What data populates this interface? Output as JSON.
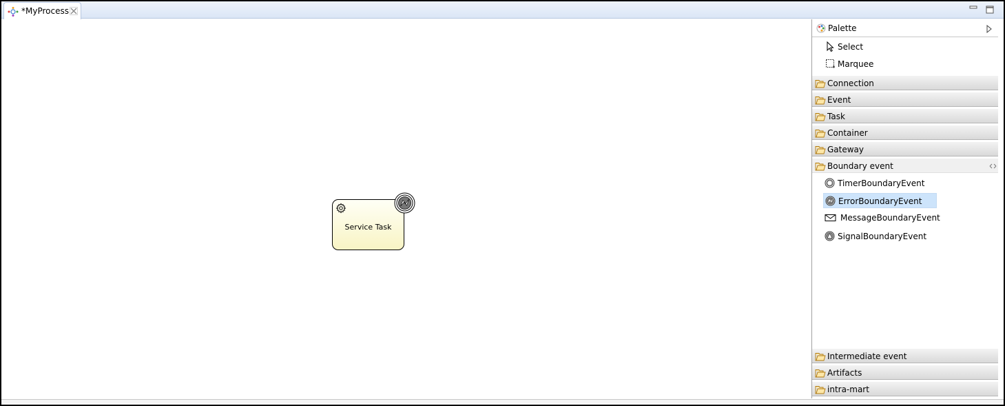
{
  "editor": {
    "tab_title": "*MyProcess"
  },
  "diagram": {
    "task_label": "Service Task"
  },
  "palette": {
    "title": "Palette",
    "tools": [
      {
        "label": "Select",
        "icon": "arrow-pointer-icon"
      },
      {
        "label": "Marquee",
        "icon": "marquee-icon"
      }
    ],
    "drawers": [
      {
        "label": "Connection",
        "open": false
      },
      {
        "label": "Event",
        "open": false
      },
      {
        "label": "Task",
        "open": false
      },
      {
        "label": "Container",
        "open": false
      },
      {
        "label": "Gateway",
        "open": false
      },
      {
        "label": "Boundary event",
        "open": true
      }
    ],
    "boundary_entries": [
      {
        "label": "TimerBoundaryEvent",
        "icon": "timer-event-icon",
        "selected": false
      },
      {
        "label": "ErrorBoundaryEvent",
        "icon": "error-event-icon",
        "selected": true
      },
      {
        "label": "MessageBoundaryEvent",
        "icon": "envelope-icon",
        "selected": false
      },
      {
        "label": "SignalBoundaryEvent",
        "icon": "signal-event-icon",
        "selected": false
      }
    ],
    "bottom_drawers": [
      {
        "label": "Intermediate event",
        "open": false
      },
      {
        "label": "Artifacts",
        "open": false
      },
      {
        "label": "intra-mart",
        "open": false
      }
    ]
  },
  "colors": {
    "selection": "#cde4fb",
    "task_fill": "#f8f4c4",
    "drawer_folder": "#f0b040"
  }
}
